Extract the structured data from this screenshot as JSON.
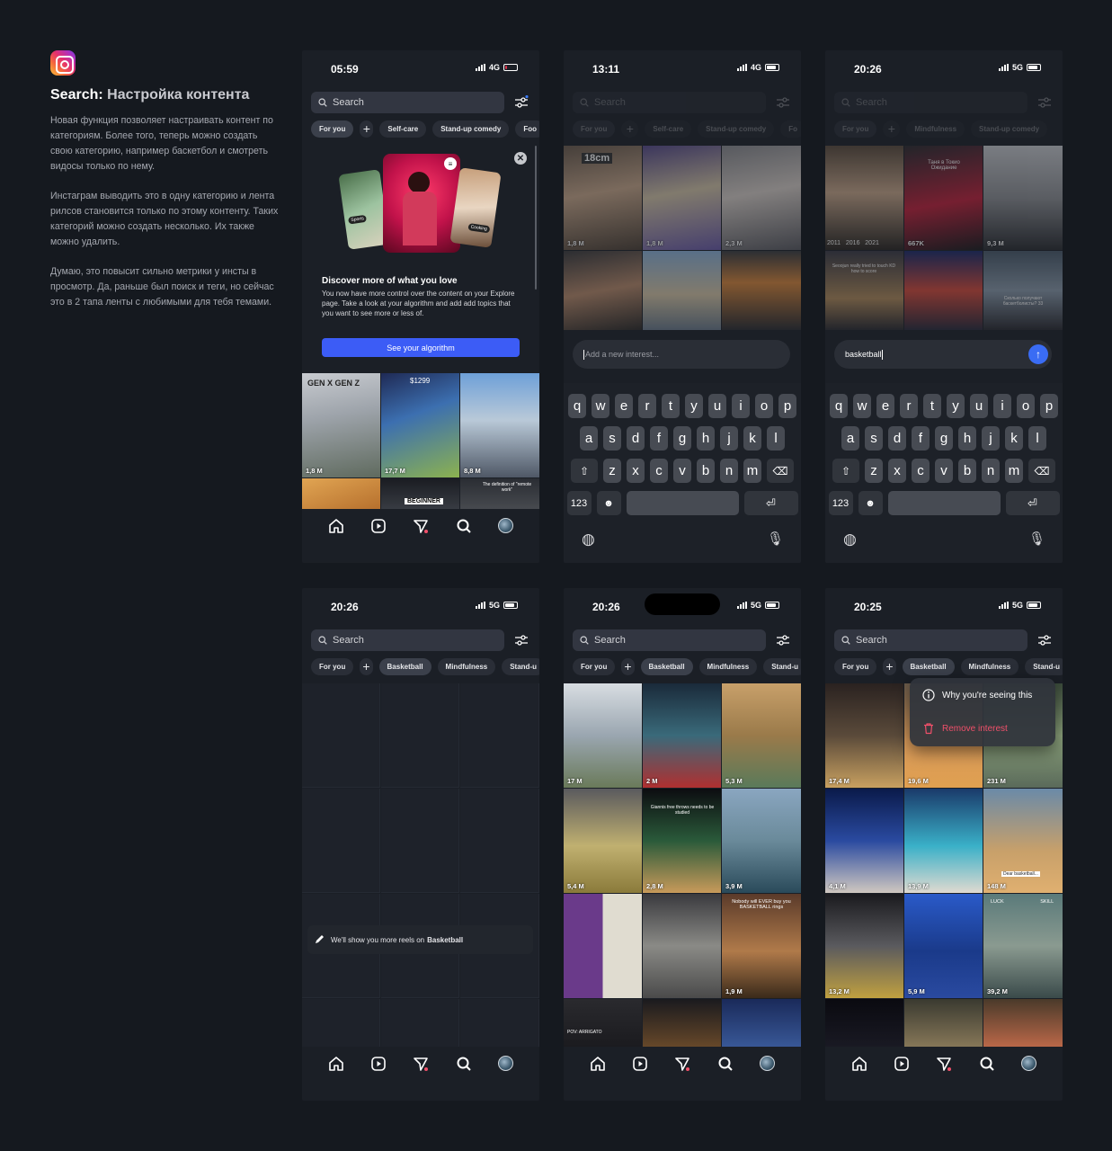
{
  "intro": {
    "title": "Search:",
    "subtitle": "Настройка контента",
    "p1": "Новая функция позволяет настраивать контент по категориям. Более того, теперь можно создать свою категорию, например баскетбол и смотреть видосы только по нему.",
    "p2": "Инстаграм выводить это в одну категорию и лента рилсов становится только по этому контенту. Таких категорий можно создать несколько. Их также можно удалить.",
    "p3": "Думаю, это повысит сильно метрики у инсты в просмотр. Да, раньше был поиск и теги, но сейчас это в 2 тапа ленты с любимыми для тебя темами."
  },
  "colors": {
    "accent": "#3c5cf6",
    "danger": "#f0506a",
    "bg": "#15191f"
  },
  "search_placeholder": "Search",
  "screen1": {
    "time": "05:59",
    "network": "4G",
    "chips": [
      "For you",
      "+",
      "Self-care",
      "Stand-up comedy",
      "Foo"
    ],
    "promo": {
      "title": "Discover more of what you love",
      "text": "You now have more control over the content on your Explore page. Take a look at your algorithm and add add topics that you want to see more or less of.",
      "button": "See your algorithm",
      "close": "✕",
      "side_labels": [
        "Sports",
        "Cooking"
      ]
    },
    "tiles": [
      {
        "label": "GEN X   GEN Z",
        "views": "1,8 M"
      },
      {
        "label": "$1299",
        "views": "17,7 M"
      },
      {
        "label": "",
        "views": "8,8 M"
      },
      {
        "label": "",
        "views": ""
      },
      {
        "label": "BEGINNER",
        "views": ""
      },
      {
        "label": "The definition of \"remote work\"",
        "views": ""
      }
    ]
  },
  "screen2": {
    "time": "13:11",
    "network": "4G",
    "chips": [
      "For you",
      "+",
      "Self-care",
      "Stand-up comedy",
      "Fo"
    ],
    "tiles": [
      {
        "label": "18cm",
        "views": "1,8 M"
      },
      {
        "label": "",
        "views": "1,8 M"
      },
      {
        "label": "",
        "views": "2,3 M"
      },
      {
        "label": "",
        "views": ""
      },
      {
        "label": "",
        "views": ""
      },
      {
        "label": "",
        "views": ""
      }
    ],
    "input_placeholder": "Add a new interest..."
  },
  "screen3": {
    "time": "20:26",
    "network": "5G",
    "chips": [
      "For you",
      "+",
      "Mindfulness",
      "Stand-up comedy"
    ],
    "tiles": [
      {
        "label": "2011   2016   2021",
        "views": ""
      },
      {
        "label": "Таня в Токио Ожидание",
        "views": "667K"
      },
      {
        "label": "",
        "views": "9,3 M"
      },
      {
        "label": "Seoojun really tried to touch KD how to score",
        "views": ""
      },
      {
        "label": "",
        "views": ""
      },
      {
        "label": "Сколько получают баскетболисты? 33",
        "views": ""
      }
    ],
    "input_value": "basketball"
  },
  "keyboard": {
    "row1": [
      "q",
      "w",
      "e",
      "r",
      "t",
      "y",
      "u",
      "i",
      "o",
      "p"
    ],
    "row2": [
      "a",
      "s",
      "d",
      "f",
      "g",
      "h",
      "j",
      "k",
      "l"
    ],
    "row3": [
      "z",
      "x",
      "c",
      "v",
      "b",
      "n",
      "m"
    ],
    "shift": "⇧",
    "backspace": "⌫",
    "numbers": "123",
    "emoji": "☻",
    "return": "⏎",
    "globe": "◍",
    "mic": "🎙"
  },
  "screen4": {
    "time": "20:26",
    "network": "5G",
    "chips": [
      "For you",
      "+",
      "Basketball",
      "Mindfulness",
      "Stand-u"
    ],
    "toast_prefix": "We'll show you more reels on",
    "toast_topic": "Basketball"
  },
  "screen5": {
    "time": "20:26",
    "network": "5G",
    "chips": [
      "For you",
      "+",
      "Basketball",
      "Mindfulness",
      "Stand-u"
    ],
    "tiles": [
      {
        "label": "",
        "views": "17 M"
      },
      {
        "label": "",
        "views": "2 M"
      },
      {
        "label": "",
        "views": "5,3 M"
      },
      {
        "label": "",
        "views": "5,4 M"
      },
      {
        "label": "Giannis free throws needs to be studied",
        "views": "2,8 M"
      },
      {
        "label": "",
        "views": "3,9 M"
      },
      {
        "label": "",
        "views": ""
      },
      {
        "label": "",
        "views": ""
      },
      {
        "label": "Nobody will EVER buy you BASKETBALL rings",
        "views": "1,9 M"
      },
      {
        "label": "POV: ARRIGATO",
        "views": ""
      },
      {
        "label": "",
        "views": ""
      },
      {
        "label": "",
        "views": ""
      }
    ]
  },
  "screen6": {
    "time": "20:25",
    "network": "5G",
    "chips": [
      "For you",
      "+",
      "Basketball",
      "Mindfulness",
      "Stand-u"
    ],
    "menu": {
      "why": "Why you're seeing this",
      "remove": "Remove interest"
    },
    "tiles": [
      {
        "label": "",
        "views": "17,4 M"
      },
      {
        "label": "",
        "views": "19,6 M"
      },
      {
        "label": "",
        "views": "231 M"
      },
      {
        "label": "",
        "views": "4,1 M"
      },
      {
        "label": "",
        "views": "13,9 M"
      },
      {
        "label": "Dear basketball...",
        "views": "148 M"
      },
      {
        "label": "",
        "views": "13,2 M"
      },
      {
        "label": "",
        "views": "5,9 M"
      },
      {
        "label": "LUCK   SKILL",
        "views": "39,2 M"
      },
      {
        "label": "",
        "views": ""
      },
      {
        "label": "",
        "views": ""
      },
      {
        "label": "",
        "views": ""
      }
    ]
  }
}
